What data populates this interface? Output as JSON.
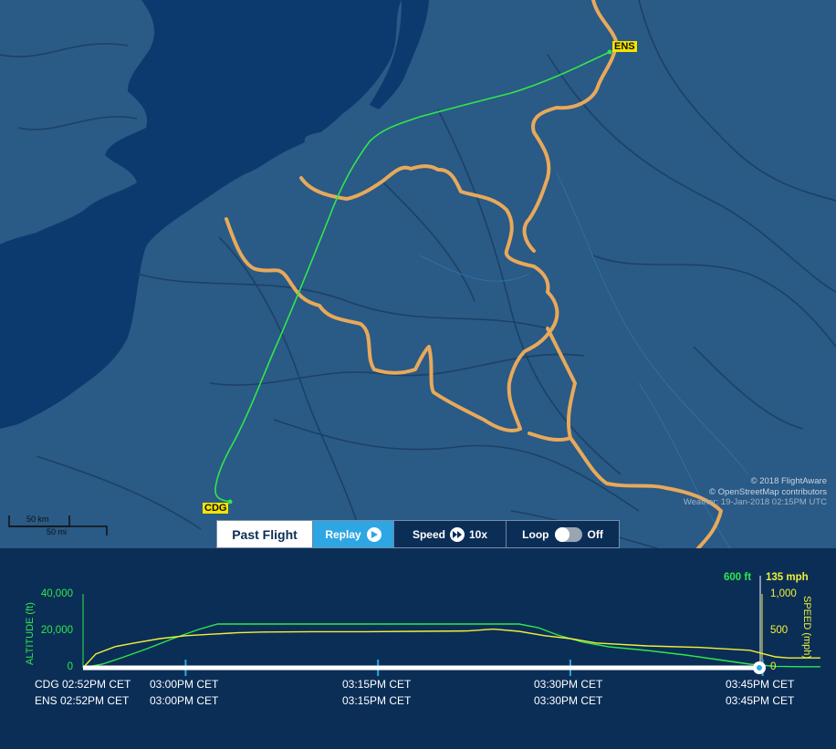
{
  "map": {
    "airports": {
      "origin": "CDG",
      "destination": "ENS"
    },
    "credits": {
      "flightaware": "© 2018 FlightAware",
      "osm": "© OpenStreetMap contributors",
      "weather": "Weather: 19-Jan-2018 02:15PM UTC"
    },
    "scale": {
      "km": "50 km",
      "mi": "50 mi"
    },
    "colors": {
      "water": "#0d3a6e",
      "land": "#2a5a86",
      "track": "#2ee84a",
      "border": "#e8a95a"
    }
  },
  "controls": {
    "past_flight": "Past Flight",
    "replay": "Replay",
    "speed_label": "Speed",
    "speed_value": "10x",
    "loop_label": "Loop",
    "loop_state": "Off"
  },
  "graph": {
    "altitude_axis_label": "ALTITUDE (ft)",
    "speed_axis_label": "SPEED (mph)",
    "altitude_ticks": [
      "40,000",
      "20,000",
      "0"
    ],
    "speed_ticks": [
      "1,000",
      "500",
      "0"
    ],
    "current_altitude": "600 ft",
    "current_speed": "135 mph",
    "time_rows": [
      [
        "CDG 02:52PM CET",
        "03:00PM CET",
        "03:15PM CET",
        "03:30PM CET",
        "03:45PM CET"
      ],
      [
        "ENS 02:52PM CET",
        "03:00PM CET",
        "03:15PM CET",
        "03:30PM CET",
        "03:45PM CET"
      ]
    ]
  },
  "chart_data": {
    "type": "line",
    "x_unit": "minutes after 02:52PM CET",
    "series": [
      {
        "name": "ALTITUDE (ft)",
        "color": "#2ee84a",
        "x": [
          0,
          1.5,
          3,
          5,
          7,
          9,
          10.5,
          12,
          14,
          18,
          22,
          26,
          30,
          34,
          35.5,
          37,
          39,
          41,
          44,
          47,
          50,
          52,
          54,
          56,
          57.5
        ],
        "values": [
          0,
          2000,
          5500,
          10500,
          16000,
          21000,
          24000,
          24000,
          24000,
          24000,
          24000,
          24000,
          24000,
          24000,
          22000,
          18000,
          14000,
          11500,
          9500,
          7000,
          4000,
          2000,
          800,
          600,
          600
        ]
      },
      {
        "name": "SPEED (mph)",
        "color": "#f1f137",
        "x": [
          0,
          1,
          2.5,
          4,
          6,
          8,
          10,
          12,
          14,
          18,
          22,
          26,
          30,
          32,
          34,
          36,
          38,
          40,
          44,
          48,
          52,
          54,
          55,
          57.5
        ],
        "values": [
          0,
          190,
          290,
          340,
          400,
          440,
          460,
          480,
          490,
          495,
          495,
          500,
          505,
          530,
          500,
          440,
          400,
          340,
          300,
          280,
          240,
          150,
          135,
          135
        ]
      }
    ],
    "altitude_range": [
      0,
      40000
    ],
    "speed_range": [
      0,
      1000
    ]
  }
}
